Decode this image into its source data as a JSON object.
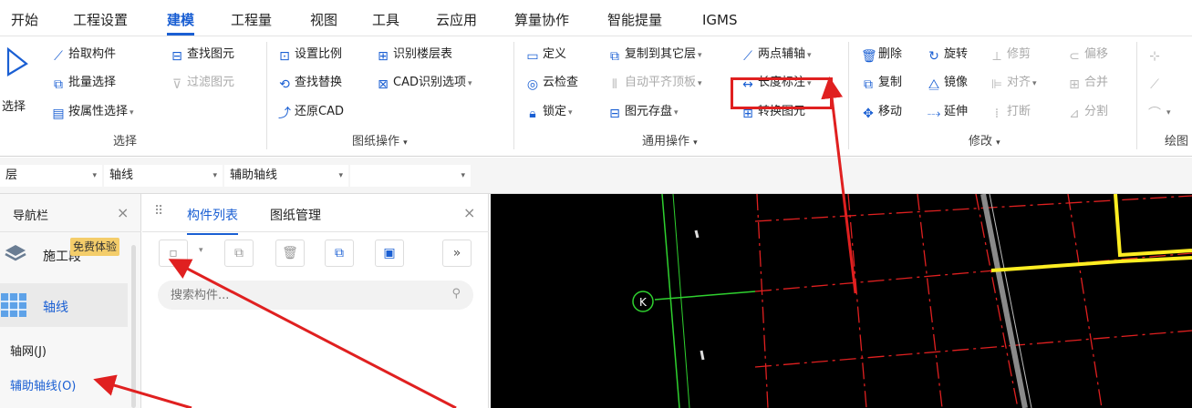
{
  "menu": [
    "开始",
    "工程设置",
    "建模",
    "工程量",
    "视图",
    "工具",
    "云应用",
    "算量协作",
    "智能提量",
    "IGMS"
  ],
  "ribbon": {
    "select_big": "选择",
    "pick": "拾取构件",
    "batch": "批量选择",
    "by_attr": "按属性选择",
    "find_elem": "查找图元",
    "filter_elem": "过滤图元",
    "set_scale": "设置比例",
    "recog_floor": "识别楼层表",
    "find_replace": "查找替换",
    "cad_options": "CAD识别选项",
    "restore_cad": "还原CAD",
    "define": "定义",
    "copy_floor": "复制到其它层",
    "two_point_axis": "两点辅轴",
    "cloud_check": "云检查",
    "auto_align": "自动平齐顶板",
    "length_dim": "长度标注",
    "lock": "锁定",
    "elem_store": "图元存盘",
    "convert_elem": "转换图元",
    "delete": "删除",
    "rotate": "旋转",
    "trim": "修剪",
    "offset": "偏移",
    "copy": "复制",
    "mirror": "镜像",
    "align": "对齐",
    "merge": "合并",
    "move": "移动",
    "extend": "延伸",
    "break": "打断",
    "split": "分割",
    "groups": {
      "select": "选择",
      "drawing_ops": "图纸操作",
      "common_ops": "通用操作",
      "modify": "修改",
      "draw": "绘图"
    }
  },
  "toolbar2": {
    "floor": "层",
    "type": "轴线",
    "subtype": "辅助轴线",
    "blank": ""
  },
  "nav": {
    "title": "导航栏",
    "promo": "免费体验",
    "construction": "施工段",
    "axis": "轴线",
    "grid": "轴网(J)",
    "aux_axis": "辅助轴线(O)"
  },
  "components": {
    "tab_list": "构件列表",
    "tab_drawings": "图纸管理",
    "search_placeholder": "搜索构件..."
  },
  "cad": {
    "axis_label": "K"
  },
  "colors": {
    "accent": "#1a5fd3",
    "highlight_box": "#e02020",
    "canvas_bg": "#000000"
  }
}
